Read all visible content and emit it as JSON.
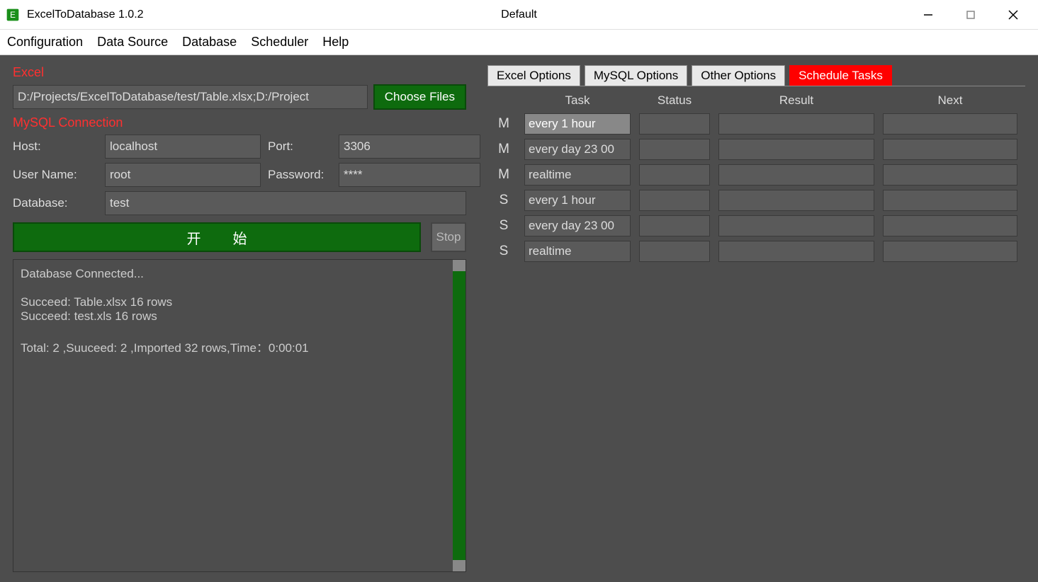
{
  "titlebar": {
    "app_title": "ExcelToDatabase 1.0.2",
    "center_title": "Default"
  },
  "menubar": {
    "items": [
      "Configuration",
      "Data Source",
      "Database",
      "Scheduler",
      "Help"
    ]
  },
  "left": {
    "excel_label": "Excel",
    "file_path": "D:/Projects/ExcelToDatabase/test/Table.xlsx;D:/Project",
    "choose_files": "Choose Files",
    "mysql_label": "MySQL Connection",
    "host_label": "Host:",
    "host_value": "localhost",
    "port_label": "Port:",
    "port_value": "3306",
    "user_label": "User Name:",
    "user_value": "root",
    "pass_label": "Password:",
    "pass_value": "****",
    "db_label": "Database:",
    "db_value": "test",
    "start_label": "开始",
    "stop_label": "Stop",
    "log_text": "Database Connected...\n\nSucceed: Table.xlsx 16 rows\nSucceed: test.xls 16 rows\n\nTotal: 2 ,Suuceed: 2 ,Imported 32 rows,Time：0:00:01"
  },
  "right": {
    "tabs": [
      "Excel Options",
      "MySQL Options",
      "Other Options",
      "Schedule Tasks"
    ],
    "active_tab": 3,
    "headers": {
      "task": "Task",
      "status": "Status",
      "result": "Result",
      "next": "Next"
    },
    "rows": [
      {
        "tag": "M",
        "task": "every 1 hour",
        "status": "",
        "result": "",
        "next": "",
        "selected": true
      },
      {
        "tag": "M",
        "task": "every day 23 00",
        "status": "",
        "result": "",
        "next": "",
        "selected": false
      },
      {
        "tag": "M",
        "task": "realtime",
        "status": "",
        "result": "",
        "next": "",
        "selected": false
      },
      {
        "tag": "S",
        "task": "every 1 hour",
        "status": "",
        "result": "",
        "next": "",
        "selected": false
      },
      {
        "tag": "S",
        "task": "every day 23 00",
        "status": "",
        "result": "",
        "next": "",
        "selected": false
      },
      {
        "tag": "S",
        "task": "realtime",
        "status": "",
        "result": "",
        "next": "",
        "selected": false
      }
    ]
  }
}
